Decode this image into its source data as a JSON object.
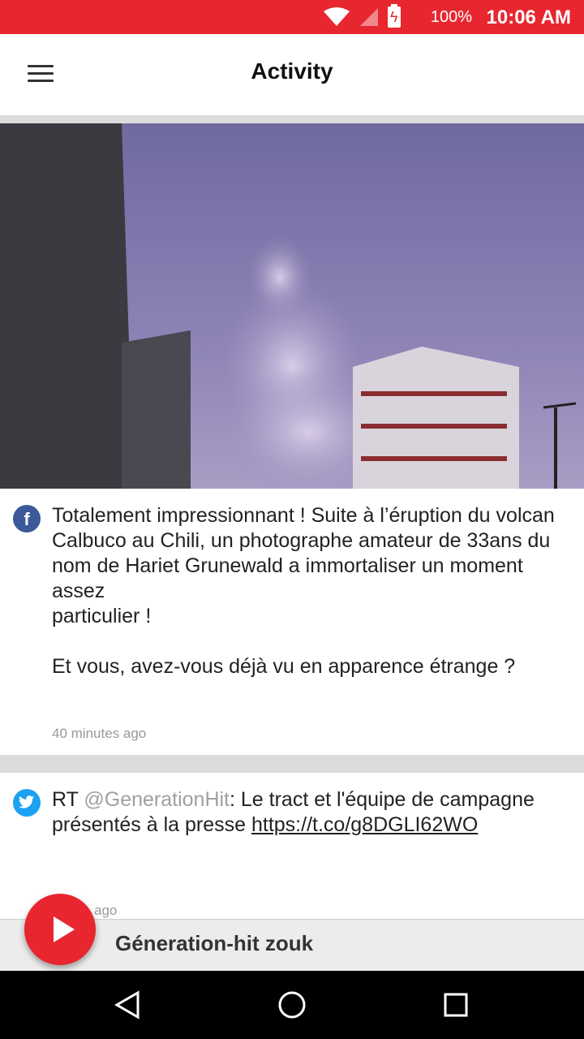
{
  "status_bar": {
    "battery_percent": "100%",
    "time": "10:06 AM"
  },
  "app_bar": {
    "title": "Activity"
  },
  "posts": [
    {
      "source": "facebook",
      "text": "Totalement impressionnant ! Suite à l’éruption du volcan Calbuco au Chili, un photographe amateur de 33ans du nom de Hariet Grunewald a immortaliser un moment assez\nparticulier !\n\nEt vous, avez-vous déjà vu en apparence étrange ?",
      "time": "40 minutes ago"
    },
    {
      "source": "twitter",
      "prefix": "RT ",
      "mention": "@GenerationHit",
      "text": ": Le tract et l'équipe de campagne présentés à la presse ",
      "link": "https://t.co/g8DGLI62WO",
      "time": "ago"
    }
  ],
  "player": {
    "station_name": "Géneration-hit zouk"
  },
  "colors": {
    "accent": "#e8262f",
    "facebook": "#3b5998",
    "twitter": "#1da1f2"
  }
}
